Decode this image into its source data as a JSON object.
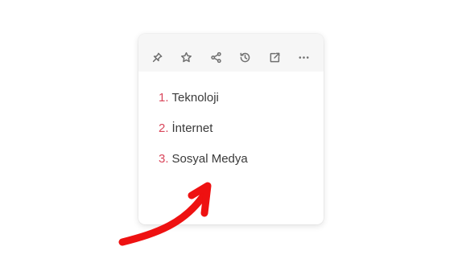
{
  "toolbar": {
    "icons": [
      "pin-icon",
      "star-icon",
      "share-icon",
      "history-icon",
      "open-external-icon",
      "more-icon"
    ]
  },
  "list": {
    "items": [
      {
        "number": "1.",
        "label": "Teknoloji"
      },
      {
        "number": "2.",
        "label": "İnternet"
      },
      {
        "number": "3.",
        "label": "Sosyal Medya"
      }
    ]
  },
  "colors": {
    "number_accent": "#d9455a",
    "arrow": "#ee1111",
    "toolbar_bg": "#f6f6f6"
  }
}
